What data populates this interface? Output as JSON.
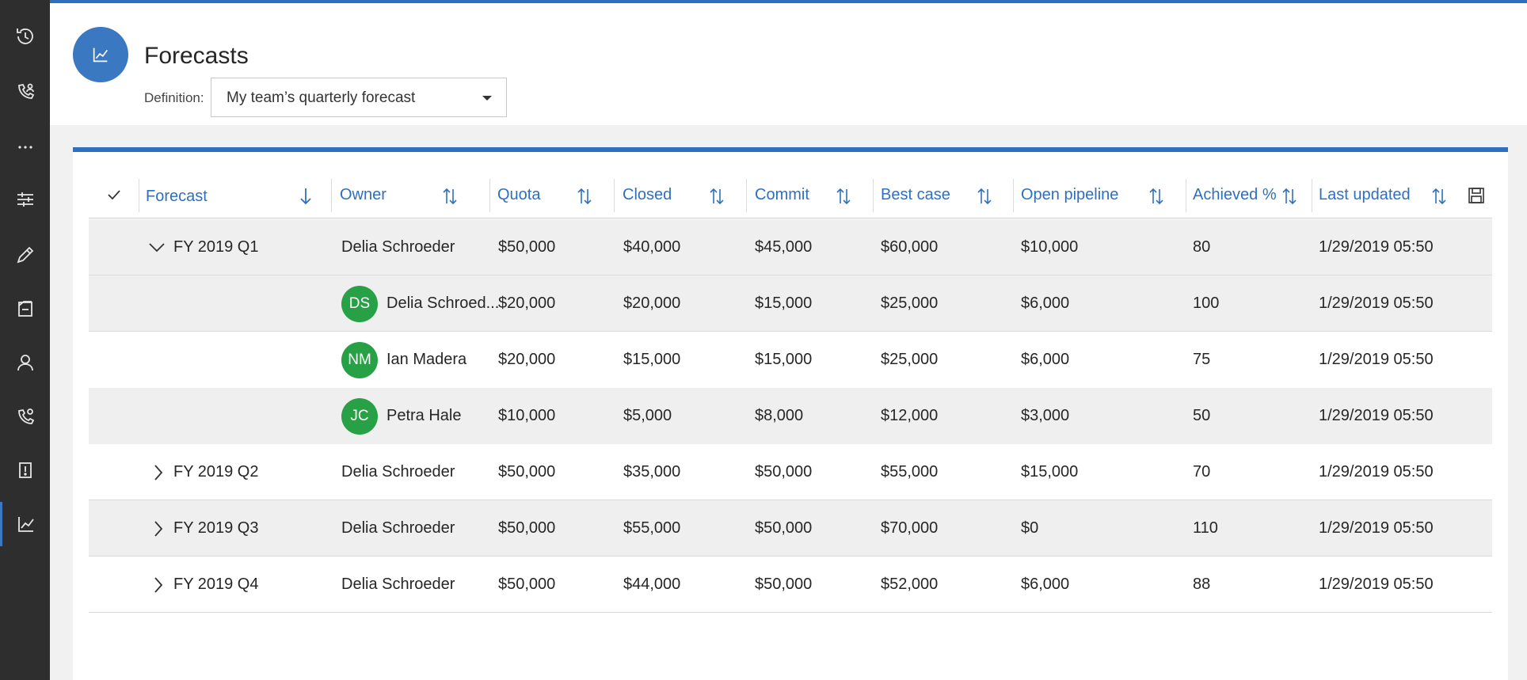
{
  "colors": {
    "accent": "#2f6fbf",
    "rail": "#2e2e2e",
    "avatar": "#27a046",
    "row_shade": "#efefef"
  },
  "rail": {
    "items": [
      {
        "icon": "history-icon"
      },
      {
        "icon": "phone-contact-icon"
      },
      {
        "icon": "more-icon"
      },
      {
        "icon": "sliders-icon"
      },
      {
        "icon": "pencil-icon"
      },
      {
        "icon": "notebook-icon"
      },
      {
        "icon": "person-icon"
      },
      {
        "icon": "phone-settings-icon"
      },
      {
        "icon": "alert-document-icon"
      },
      {
        "icon": "chart-icon",
        "active": true
      }
    ]
  },
  "header": {
    "icon": "chart-icon",
    "title": "Forecasts",
    "definition_label": "Definition:",
    "definition_value": "My team’s quarterly forecast"
  },
  "grid": {
    "columns": [
      {
        "label": "Forecast",
        "sort": "down-arrow-icon"
      },
      {
        "label": "Owner",
        "sort": "sort-icon"
      },
      {
        "label": "Quota",
        "sort": "sort-icon"
      },
      {
        "label": "Closed",
        "sort": "sort-icon"
      },
      {
        "label": "Commit",
        "sort": "sort-icon"
      },
      {
        "label": "Best case",
        "sort": "sort-icon"
      },
      {
        "label": "Open pipeline",
        "sort": "sort-icon"
      },
      {
        "label": "Achieved %",
        "sort": "sort-icon"
      },
      {
        "label": "Last updated",
        "sort": "sort-icon"
      }
    ],
    "rows": [
      {
        "type": "group",
        "expanded": true,
        "forecast": "FY 2019 Q1",
        "owner": "Delia Schroeder",
        "quota": "$50,000",
        "closed": "$40,000",
        "commit": "$45,000",
        "best_case": "$60,000",
        "open_pipeline": "$10,000",
        "achieved": "80",
        "last_updated": "1/29/2019 05:50"
      },
      {
        "type": "child",
        "initials": "DS",
        "owner": "Delia Schroed...",
        "quota": "$20,000",
        "closed": "$20,000",
        "commit": "$15,000",
        "best_case": "$25,000",
        "open_pipeline": "$6,000",
        "achieved": "100",
        "last_updated": "1/29/2019 05:50"
      },
      {
        "type": "child",
        "initials": "NM",
        "owner": "Ian Madera",
        "quota": "$20,000",
        "closed": "$15,000",
        "commit": "$15,000",
        "best_case": "$25,000",
        "open_pipeline": "$6,000",
        "achieved": "75",
        "last_updated": "1/29/2019 05:50"
      },
      {
        "type": "child",
        "initials": "JC",
        "owner": "Petra Hale",
        "quota": "$10,000",
        "closed": "$5,000",
        "commit": "$8,000",
        "best_case": "$12,000",
        "open_pipeline": "$3,000",
        "achieved": "50",
        "last_updated": "1/29/2019 05:50"
      },
      {
        "type": "group",
        "expanded": false,
        "forecast": "FY 2019 Q2",
        "owner": "Delia Schroeder",
        "quota": "$50,000",
        "closed": "$35,000",
        "commit": "$50,000",
        "best_case": "$55,000",
        "open_pipeline": "$15,000",
        "achieved": "70",
        "last_updated": "1/29/2019 05:50"
      },
      {
        "type": "group",
        "expanded": false,
        "forecast": "FY 2019 Q3",
        "owner": "Delia Schroeder",
        "quota": "$50,000",
        "closed": "$55,000",
        "commit": "$50,000",
        "best_case": "$70,000",
        "open_pipeline": "$0",
        "achieved": "110",
        "last_updated": "1/29/2019 05:50"
      },
      {
        "type": "group",
        "expanded": false,
        "forecast": "FY 2019 Q4",
        "owner": "Delia Schroeder",
        "quota": "$50,000",
        "closed": "$44,000",
        "commit": "$50,000",
        "best_case": "$52,000",
        "open_pipeline": "$6,000",
        "achieved": "88",
        "last_updated": "1/29/2019 05:50"
      }
    ]
  }
}
